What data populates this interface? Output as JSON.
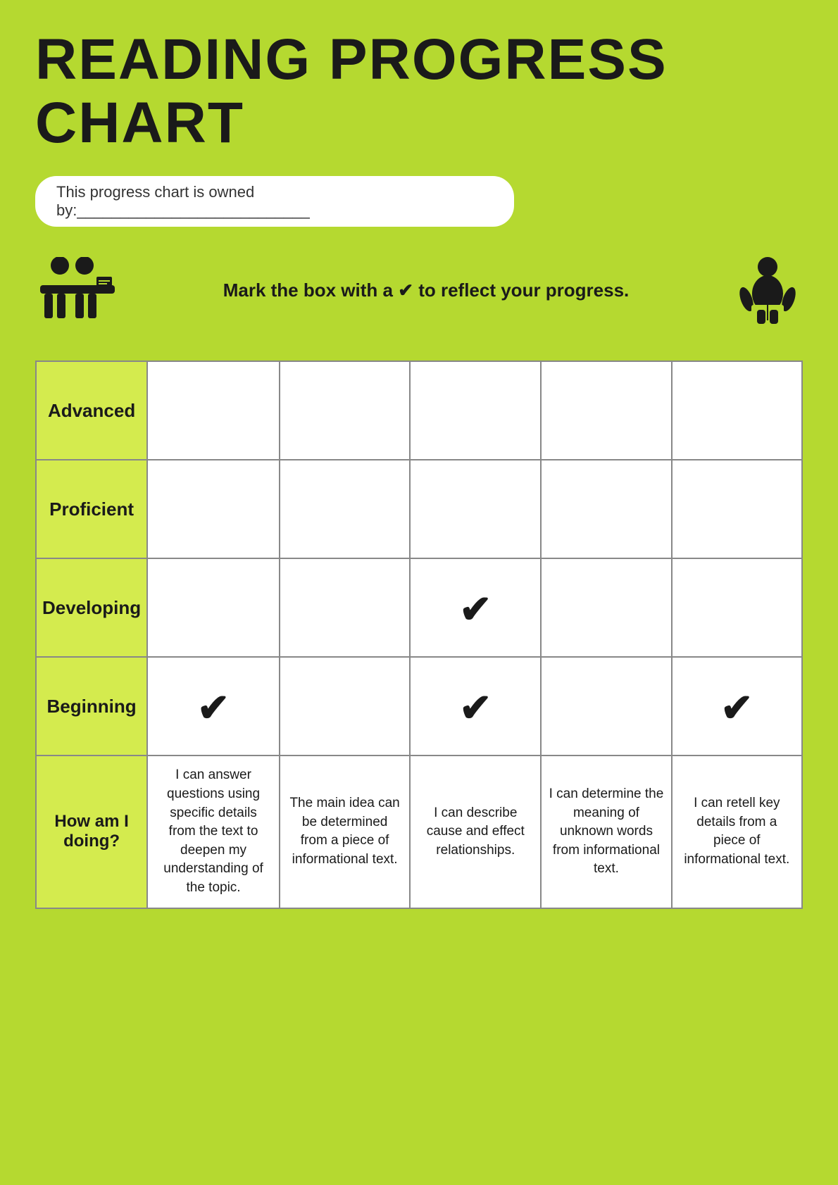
{
  "title": "READING PROGRESS CHART",
  "ownership_label": "This progress chart is owned by:___________________________",
  "instruction": "Mark the box with a ✔ to reflect your progress.",
  "rows": [
    {
      "id": "advanced",
      "label": "Advanced",
      "checks": [
        false,
        false,
        false,
        false,
        false
      ]
    },
    {
      "id": "proficient",
      "label": "Proficient",
      "checks": [
        false,
        false,
        false,
        false,
        false
      ]
    },
    {
      "id": "developing",
      "label": "Developing",
      "checks": [
        false,
        false,
        true,
        false,
        false
      ]
    },
    {
      "id": "beginning",
      "label": "Beginning",
      "checks": [
        true,
        false,
        true,
        false,
        true
      ]
    }
  ],
  "how_am_i_label": "How am I doing?",
  "descriptions": [
    "I can answer questions using specific details from the text to deepen my understanding of the topic.",
    "The main idea can be determined from a piece of informational text.",
    "I can describe cause and effect relationships.",
    "I can determine the meaning of unknown words from informational text.",
    "I can retell key details from a piece of informational text."
  ],
  "icons": {
    "left": "teacher-with-book-icon",
    "right": "person-reading-icon"
  },
  "colors": {
    "background": "#b5d930",
    "label_cell_bg": "#d4eb4e",
    "cell_bg": "#ffffff",
    "text_dark": "#1a1a1a",
    "border": "#888888"
  }
}
